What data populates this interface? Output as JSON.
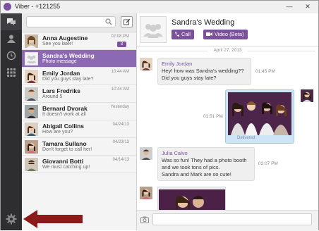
{
  "window": {
    "title": "Viber - +121255",
    "minimize": "—",
    "close": "✕"
  },
  "rail": {
    "icons": [
      "chat-bubbles-icon",
      "contacts-icon",
      "recents-clock-icon",
      "dialpad-icon",
      "settings-gear-icon"
    ]
  },
  "search": {
    "placeholder": ""
  },
  "contacts": [
    {
      "name": "Anna Augestine",
      "message": "See you later!",
      "time": "02:08 PM",
      "badge": "3"
    },
    {
      "name": "Sandra's Wedding",
      "message": "Photo message",
      "time": "01:52 PM",
      "badge": ""
    },
    {
      "name": "Emily Jordan",
      "message": "Did you guys stay late?",
      "time": "10:44 AM",
      "badge": ""
    },
    {
      "name": "Lars Fredriks",
      "message": "Around 5",
      "time": "10:44 AM",
      "badge": ""
    },
    {
      "name": "Bernard Dvorak",
      "message": "It doesn't work at all",
      "time": "Yesterday",
      "badge": ""
    },
    {
      "name": "Abigail Collins",
      "message": "How are you?",
      "time": "04/24/13",
      "badge": ""
    },
    {
      "name": "Tamara Sullano",
      "message": "Don't forget to call her!",
      "time": "04/23/13",
      "badge": ""
    },
    {
      "name": "Giovanni Botti",
      "message": "We must catching up!",
      "time": "04/14/13",
      "badge": ""
    }
  ],
  "chat": {
    "title": "Sandra's Wedding",
    "call_label": "Call",
    "video_label": "Video (Beta)",
    "date": "April 27, 2013",
    "messages": [
      {
        "sender": "Emily Jordan",
        "text": [
          "Hey! how was Sandra's wedding??",
          "Did you guys stay late?"
        ],
        "time": "01:45 PM"
      },
      {
        "sender": "",
        "text": [
          "Delivered"
        ],
        "time": "01:51 PM"
      },
      {
        "sender": "Julia Calvo",
        "text": [
          "Was so fun! They had a photo booth",
          "and we took tons of pics.",
          "Sandra and Mark are so cute!"
        ],
        "time": "02:07 PM"
      }
    ]
  },
  "colors": {
    "brand": "#7b519d",
    "active_row": "#8c69b2",
    "rail": "#2e2e30",
    "outgoing_bubble": "#cde6f6",
    "annotation_arrow": "#8b1a1a"
  }
}
